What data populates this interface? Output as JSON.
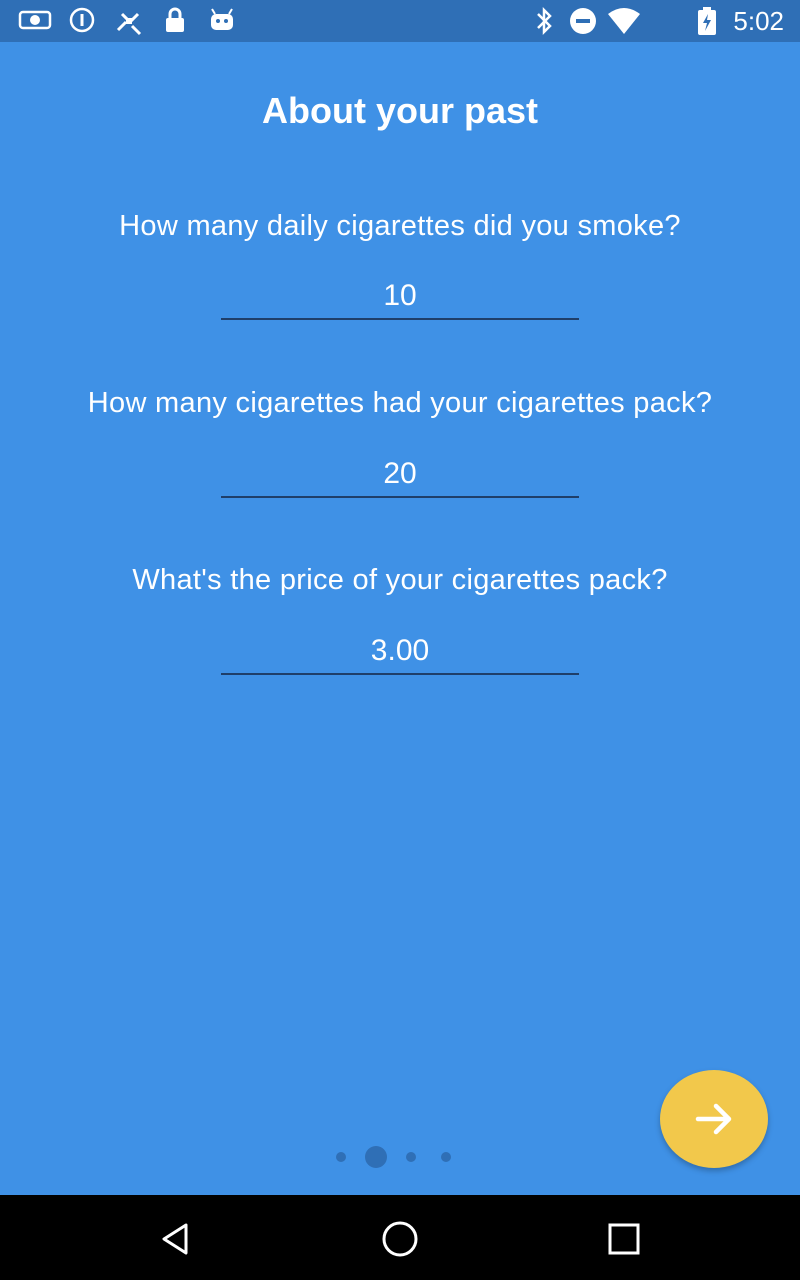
{
  "status_bar": {
    "time": "5:02",
    "left_icons": [
      "mail-icon",
      "info-icon",
      "satellite-icon",
      "lock-icon",
      "android-icon"
    ],
    "right_icons": [
      "bluetooth-icon",
      "do-not-disturb-icon",
      "wifi-icon",
      "battery-icon"
    ]
  },
  "page": {
    "title": "About your past",
    "questions": [
      {
        "label": "How many daily cigarettes did you smoke?",
        "value": "10"
      },
      {
        "label": "How many cigarettes had your cigarettes pack?",
        "value": "20"
      },
      {
        "label": "What's the price of your cigarettes pack?",
        "value": "3.00"
      }
    ]
  },
  "pager": {
    "total": 4,
    "current": 2
  },
  "next_button": {
    "icon": "arrow-right-icon"
  },
  "nav_bar": {
    "icons": [
      "back-icon",
      "home-icon",
      "recents-icon"
    ]
  },
  "colors": {
    "background": "#3f91e6",
    "status_bar": "#2f6fb6",
    "accent": "#f2c84b",
    "nav_bar": "#000000"
  }
}
